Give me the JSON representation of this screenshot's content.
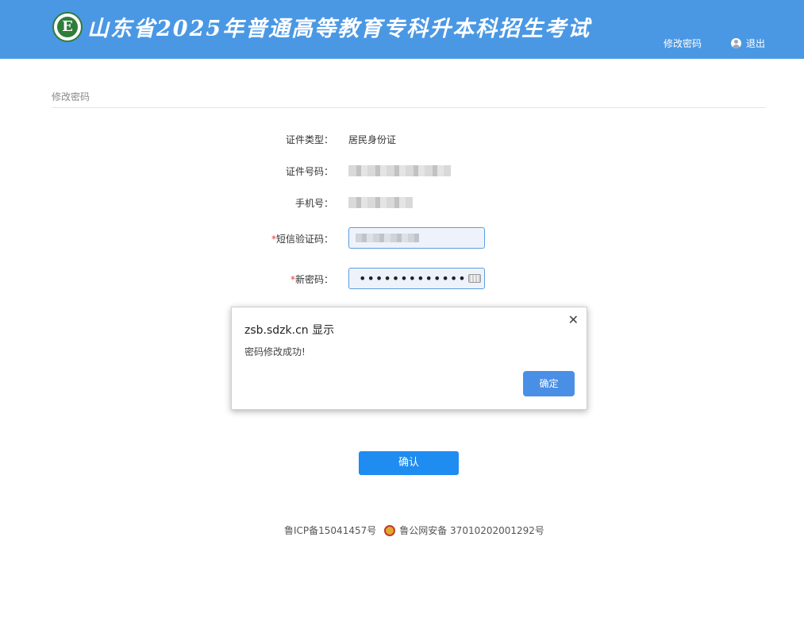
{
  "header": {
    "logo_letter": "E",
    "title": "山东省2025年普通高等教育专科升本科招生考试",
    "nav_change_password": "修改密码",
    "nav_logout": "退出"
  },
  "breadcrumb": "修改密码",
  "form": {
    "id_type_label": "证件类型：",
    "id_type_value": "居民身份证",
    "id_number_label": "证件号码：",
    "phone_label": "手机号：",
    "sms_code_label": "短信验证码：",
    "new_password_label": "新密码：",
    "required_mark": "*",
    "new_password_value": "••••••••••••••"
  },
  "confirm_button": "确认",
  "dialog": {
    "title": "zsb.sdzk.cn 显示",
    "message": "密码修改成功!",
    "close": "✕",
    "ok_button": "确定"
  },
  "footer": {
    "icp": "鲁ICP备15041457号",
    "police": "鲁公网安备 37010202001292号"
  },
  "colors": {
    "header_bg": "#4a98e4",
    "primary_button": "#1e8cf0",
    "required": "#e33333"
  }
}
